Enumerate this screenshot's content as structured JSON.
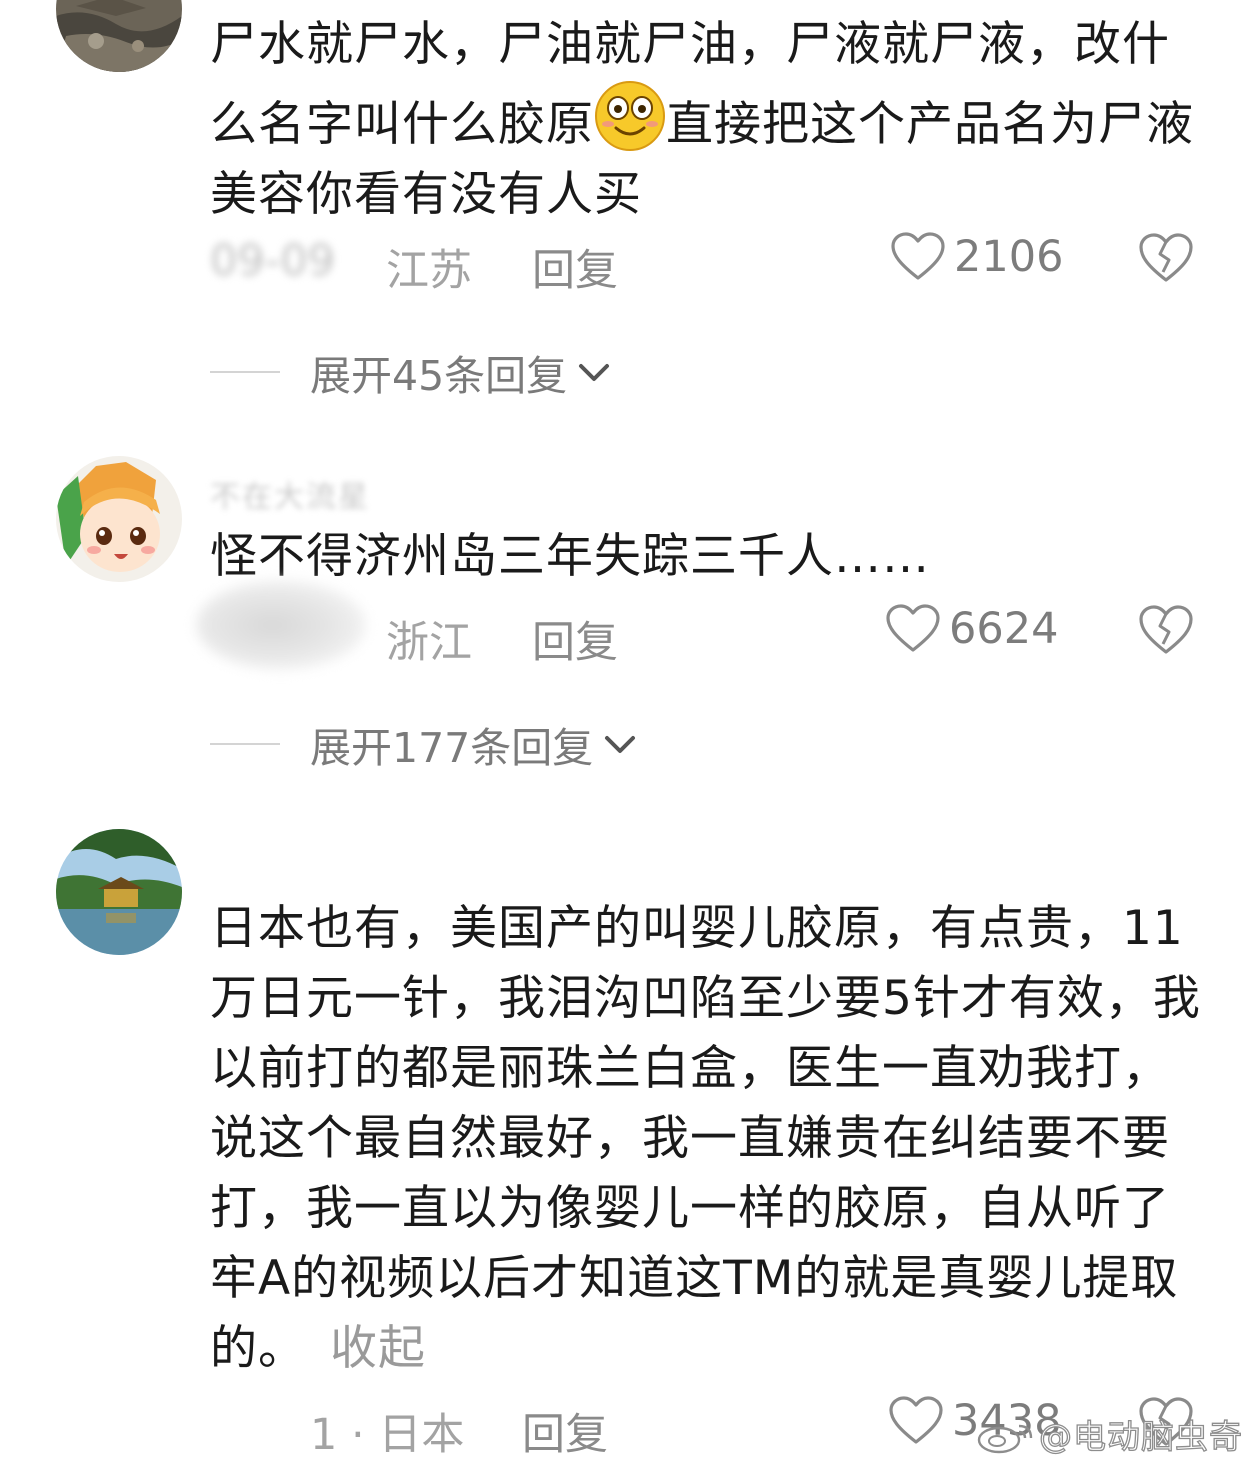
{
  "comments": [
    {
      "avatar": "rock-photo-avatar",
      "content": "尸水就尸水，尸油就尸油，尸液就尸液，改什么名字叫什么胶原",
      "content_after_emoji": "直接把这个产品名为尸液美容你看有没有人买",
      "emoji": "dizzy-smile-emoji",
      "time": "09-09",
      "region": "江苏",
      "reply": "回复",
      "likes": "2106",
      "expand": "展开45条回复"
    },
    {
      "avatar": "anime-girl-avatar",
      "username": "不在大流星",
      "content": "怪不得济州岛三年失踪三千人……",
      "region": "浙江",
      "reply": "回复",
      "likes": "6624",
      "expand": "展开177条回复"
    },
    {
      "avatar": "golden-pavilion-avatar",
      "content": "日本也有，美国产的叫婴儿胶原，有点贵，11万日元一针，我泪沟凹陷至少要5针才有效，我以前打的都是丽珠兰白盒，医生一直劝我打，说这个最自然最好，我一直嫌贵在纠结要不要打，我一直以为像婴儿一样的胶原，自从听了牢A的视频以后才知道这TM的就是真婴儿提取的。",
      "collapse": "收起",
      "time": "1 · 日本",
      "reply": "回复",
      "likes": "3438"
    }
  ],
  "watermark": "@电动脑虫奇"
}
